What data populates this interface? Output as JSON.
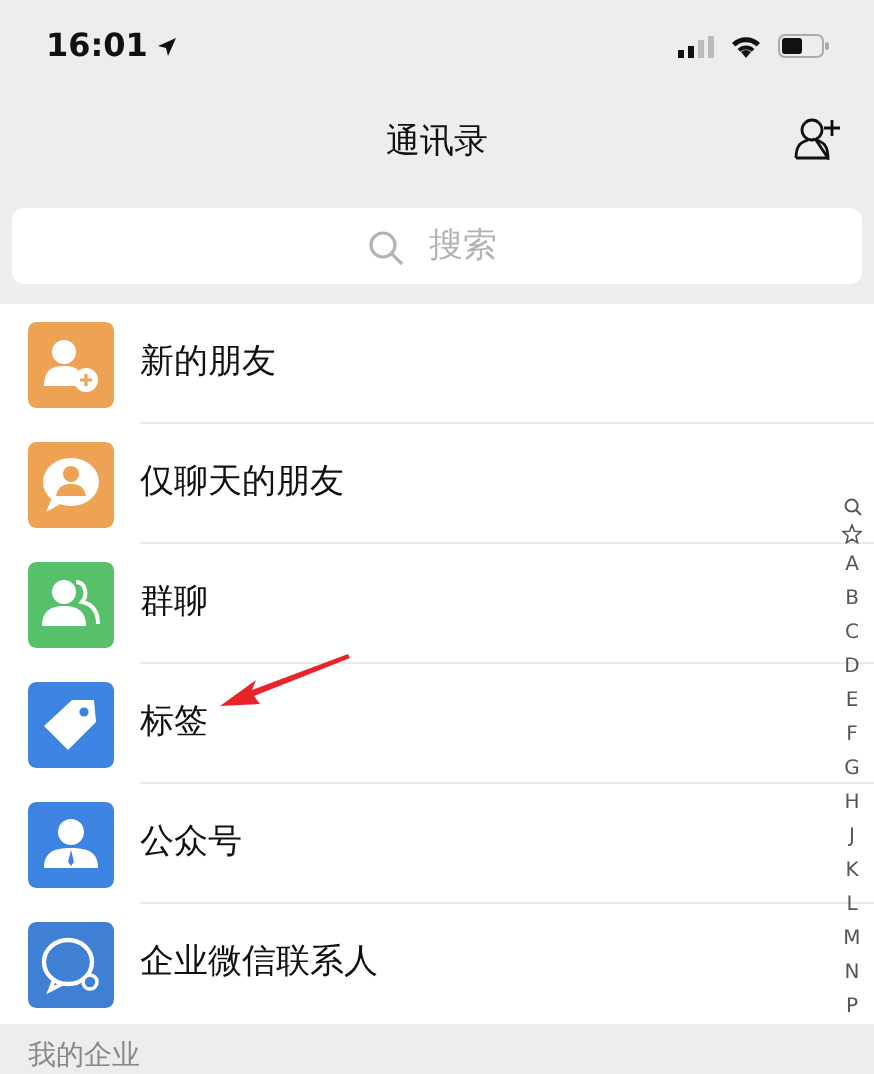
{
  "status_bar": {
    "time": "16:01"
  },
  "nav": {
    "title": "通讯录"
  },
  "search": {
    "placeholder": "搜索"
  },
  "items": [
    {
      "label": "新的朋友",
      "kind": "new-friend",
      "color": "#eda353"
    },
    {
      "label": "仅聊天的朋友",
      "kind": "chat-only",
      "color": "#eda353"
    },
    {
      "label": "群聊",
      "kind": "group",
      "color": "#57c06b"
    },
    {
      "label": "标签",
      "kind": "tag",
      "color": "#3d83e2"
    },
    {
      "label": "公众号",
      "kind": "official",
      "color": "#3d83e2"
    },
    {
      "label": "企业微信联系人",
      "kind": "enterprise",
      "color": "#3f7fd4"
    }
  ],
  "section_header": "我的企业",
  "index_bar": [
    "A",
    "B",
    "C",
    "D",
    "E",
    "F",
    "G",
    "H",
    "J",
    "K",
    "L",
    "M",
    "N",
    "P"
  ],
  "annotation": {
    "kind": "arrow"
  }
}
